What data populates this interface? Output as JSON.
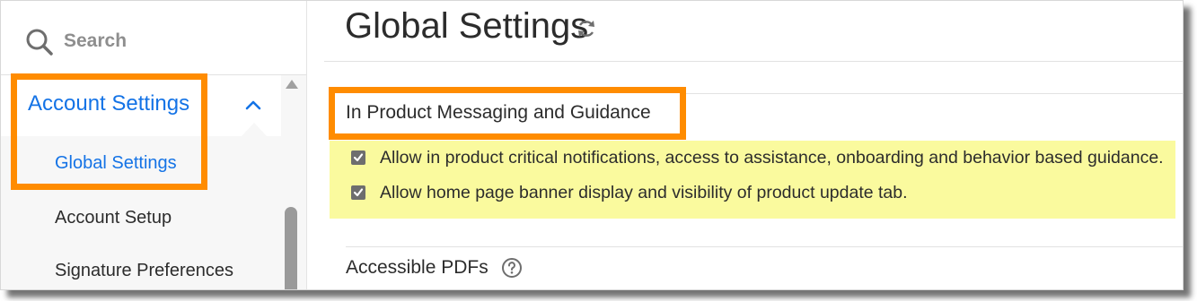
{
  "sidebar": {
    "search_placeholder": "Search",
    "section_label": "Account Settings",
    "items": [
      {
        "label": "Global Settings",
        "active": true
      },
      {
        "label": "Account Setup",
        "active": false
      },
      {
        "label": "Signature Preferences",
        "active": false
      }
    ]
  },
  "main": {
    "title": "Global Settings",
    "section": {
      "title": "In Product Messaging and Guidance",
      "options": [
        {
          "label": "Allow in product critical notifications, access to assistance, onboarding and behavior based guidance.",
          "checked": true
        },
        {
          "label": "Allow home page banner display and visibility of product update tab.",
          "checked": true
        }
      ]
    },
    "next_section_title": "Accessible PDFs"
  },
  "colors": {
    "accent": "#1473e6",
    "highlight_box": "#ff8c00",
    "highlight_fill": "#fafa9e"
  },
  "icons": [
    "search-icon",
    "chevron-up-icon",
    "refresh-icon",
    "checkbox-checked-icon",
    "help-icon"
  ]
}
